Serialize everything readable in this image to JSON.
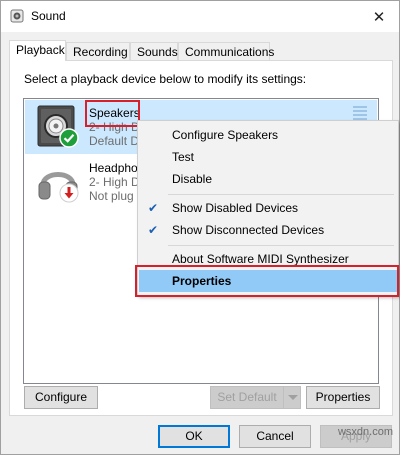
{
  "window": {
    "title": "Sound",
    "close_glyph": "✕"
  },
  "tabs": [
    {
      "label": "Playback",
      "active": true
    },
    {
      "label": "Recording",
      "active": false
    },
    {
      "label": "Sounds",
      "active": false
    },
    {
      "label": "Communications",
      "active": false
    }
  ],
  "instruction": "Select a playback device below to modify its settings:",
  "devices": [
    {
      "name": "Speakers",
      "line2": "2- High D",
      "line3": "Default D",
      "icon": "speaker-icon",
      "status_icon": "green-check-icon",
      "selected": true
    },
    {
      "name": "Headpho",
      "line2": "2- High D",
      "line3": "Not plug",
      "icon": "headphones-icon",
      "status_icon": "red-down-arrow-icon",
      "selected": false
    }
  ],
  "context_menu": {
    "items": [
      {
        "label": "Configure Speakers",
        "checked": false
      },
      {
        "label": "Test",
        "checked": false
      },
      {
        "label": "Disable",
        "checked": false
      },
      {
        "label": "Show Disabled Devices",
        "checked": true
      },
      {
        "label": "Show Disconnected Devices",
        "checked": true
      },
      {
        "label": "About Software MIDI Synthesizer",
        "checked": false
      },
      {
        "label": "Properties",
        "checked": false,
        "hovered": true
      }
    ],
    "check_glyph": "✔"
  },
  "panel_buttons": {
    "configure": "Configure",
    "set_default": "Set Default",
    "properties": "Properties"
  },
  "dialog_buttons": {
    "ok": "OK",
    "cancel": "Cancel",
    "apply": "Apply"
  },
  "watermark": "wsxdn.com",
  "colors": {
    "selection": "#cce8ff",
    "menu_hover": "#91c9f7",
    "highlight_border": "#d6202c",
    "default_button_border": "#0078d7"
  }
}
